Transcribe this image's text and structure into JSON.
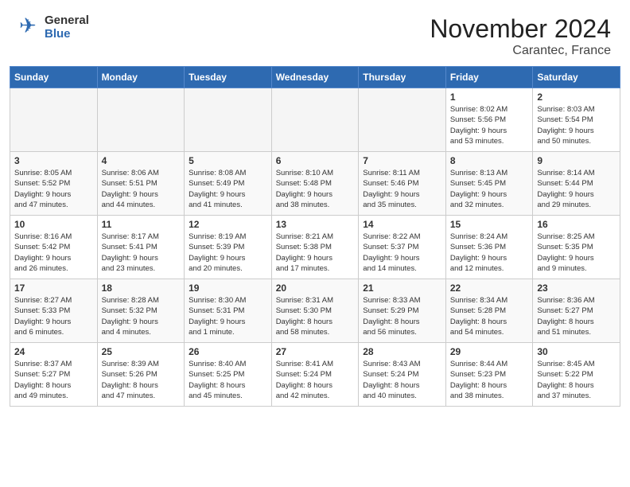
{
  "header": {
    "logo_general": "General",
    "logo_blue": "Blue",
    "month_title": "November 2024",
    "location": "Carantec, France"
  },
  "weekdays": [
    "Sunday",
    "Monday",
    "Tuesday",
    "Wednesday",
    "Thursday",
    "Friday",
    "Saturday"
  ],
  "weeks": [
    [
      {
        "day": "",
        "info": ""
      },
      {
        "day": "",
        "info": ""
      },
      {
        "day": "",
        "info": ""
      },
      {
        "day": "",
        "info": ""
      },
      {
        "day": "",
        "info": ""
      },
      {
        "day": "1",
        "info": "Sunrise: 8:02 AM\nSunset: 5:56 PM\nDaylight: 9 hours\nand 53 minutes."
      },
      {
        "day": "2",
        "info": "Sunrise: 8:03 AM\nSunset: 5:54 PM\nDaylight: 9 hours\nand 50 minutes."
      }
    ],
    [
      {
        "day": "3",
        "info": "Sunrise: 8:05 AM\nSunset: 5:52 PM\nDaylight: 9 hours\nand 47 minutes."
      },
      {
        "day": "4",
        "info": "Sunrise: 8:06 AM\nSunset: 5:51 PM\nDaylight: 9 hours\nand 44 minutes."
      },
      {
        "day": "5",
        "info": "Sunrise: 8:08 AM\nSunset: 5:49 PM\nDaylight: 9 hours\nand 41 minutes."
      },
      {
        "day": "6",
        "info": "Sunrise: 8:10 AM\nSunset: 5:48 PM\nDaylight: 9 hours\nand 38 minutes."
      },
      {
        "day": "7",
        "info": "Sunrise: 8:11 AM\nSunset: 5:46 PM\nDaylight: 9 hours\nand 35 minutes."
      },
      {
        "day": "8",
        "info": "Sunrise: 8:13 AM\nSunset: 5:45 PM\nDaylight: 9 hours\nand 32 minutes."
      },
      {
        "day": "9",
        "info": "Sunrise: 8:14 AM\nSunset: 5:44 PM\nDaylight: 9 hours\nand 29 minutes."
      }
    ],
    [
      {
        "day": "10",
        "info": "Sunrise: 8:16 AM\nSunset: 5:42 PM\nDaylight: 9 hours\nand 26 minutes."
      },
      {
        "day": "11",
        "info": "Sunrise: 8:17 AM\nSunset: 5:41 PM\nDaylight: 9 hours\nand 23 minutes."
      },
      {
        "day": "12",
        "info": "Sunrise: 8:19 AM\nSunset: 5:39 PM\nDaylight: 9 hours\nand 20 minutes."
      },
      {
        "day": "13",
        "info": "Sunrise: 8:21 AM\nSunset: 5:38 PM\nDaylight: 9 hours\nand 17 minutes."
      },
      {
        "day": "14",
        "info": "Sunrise: 8:22 AM\nSunset: 5:37 PM\nDaylight: 9 hours\nand 14 minutes."
      },
      {
        "day": "15",
        "info": "Sunrise: 8:24 AM\nSunset: 5:36 PM\nDaylight: 9 hours\nand 12 minutes."
      },
      {
        "day": "16",
        "info": "Sunrise: 8:25 AM\nSunset: 5:35 PM\nDaylight: 9 hours\nand 9 minutes."
      }
    ],
    [
      {
        "day": "17",
        "info": "Sunrise: 8:27 AM\nSunset: 5:33 PM\nDaylight: 9 hours\nand 6 minutes."
      },
      {
        "day": "18",
        "info": "Sunrise: 8:28 AM\nSunset: 5:32 PM\nDaylight: 9 hours\nand 4 minutes."
      },
      {
        "day": "19",
        "info": "Sunrise: 8:30 AM\nSunset: 5:31 PM\nDaylight: 9 hours\nand 1 minute."
      },
      {
        "day": "20",
        "info": "Sunrise: 8:31 AM\nSunset: 5:30 PM\nDaylight: 8 hours\nand 58 minutes."
      },
      {
        "day": "21",
        "info": "Sunrise: 8:33 AM\nSunset: 5:29 PM\nDaylight: 8 hours\nand 56 minutes."
      },
      {
        "day": "22",
        "info": "Sunrise: 8:34 AM\nSunset: 5:28 PM\nDaylight: 8 hours\nand 54 minutes."
      },
      {
        "day": "23",
        "info": "Sunrise: 8:36 AM\nSunset: 5:27 PM\nDaylight: 8 hours\nand 51 minutes."
      }
    ],
    [
      {
        "day": "24",
        "info": "Sunrise: 8:37 AM\nSunset: 5:27 PM\nDaylight: 8 hours\nand 49 minutes."
      },
      {
        "day": "25",
        "info": "Sunrise: 8:39 AM\nSunset: 5:26 PM\nDaylight: 8 hours\nand 47 minutes."
      },
      {
        "day": "26",
        "info": "Sunrise: 8:40 AM\nSunset: 5:25 PM\nDaylight: 8 hours\nand 45 minutes."
      },
      {
        "day": "27",
        "info": "Sunrise: 8:41 AM\nSunset: 5:24 PM\nDaylight: 8 hours\nand 42 minutes."
      },
      {
        "day": "28",
        "info": "Sunrise: 8:43 AM\nSunset: 5:24 PM\nDaylight: 8 hours\nand 40 minutes."
      },
      {
        "day": "29",
        "info": "Sunrise: 8:44 AM\nSunset: 5:23 PM\nDaylight: 8 hours\nand 38 minutes."
      },
      {
        "day": "30",
        "info": "Sunrise: 8:45 AM\nSunset: 5:22 PM\nDaylight: 8 hours\nand 37 minutes."
      }
    ]
  ]
}
